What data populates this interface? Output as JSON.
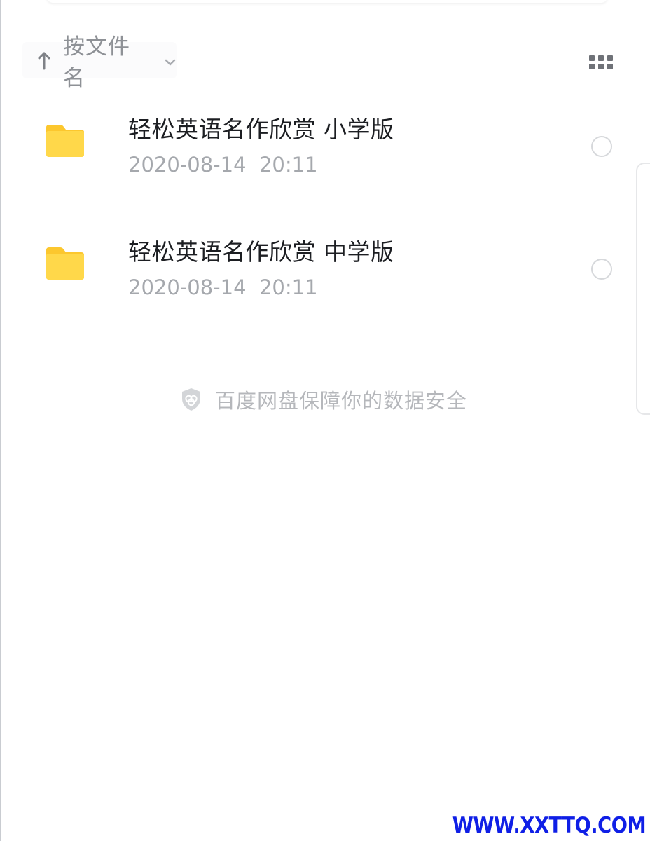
{
  "sort_bar": {
    "label": "按文件名",
    "direction_icon": "arrow-up-icon",
    "dropdown_icon": "chevron-down-icon"
  },
  "view_toggle": {
    "icon": "grid-view-icon"
  },
  "files": [
    {
      "name": "轻松英语名作欣赏 小学版",
      "date": "2020-08-14  20:11",
      "icon": "folder-icon"
    },
    {
      "name": "轻松英语名作欣赏 中学版",
      "date": "2020-08-14  20:11",
      "icon": "folder-icon"
    }
  ],
  "security_notice": {
    "text": "百度网盘保障你的数据安全",
    "icon": "shield-icon"
  },
  "watermark": {
    "text": "WWW.XXTTQ.COM"
  },
  "colors": {
    "folder": "#FFD84A",
    "folder_tab": "#FCC72E",
    "title_text": "#1C1E22",
    "meta_text": "#A5A8AD",
    "watermark": "#0F1FE6"
  }
}
